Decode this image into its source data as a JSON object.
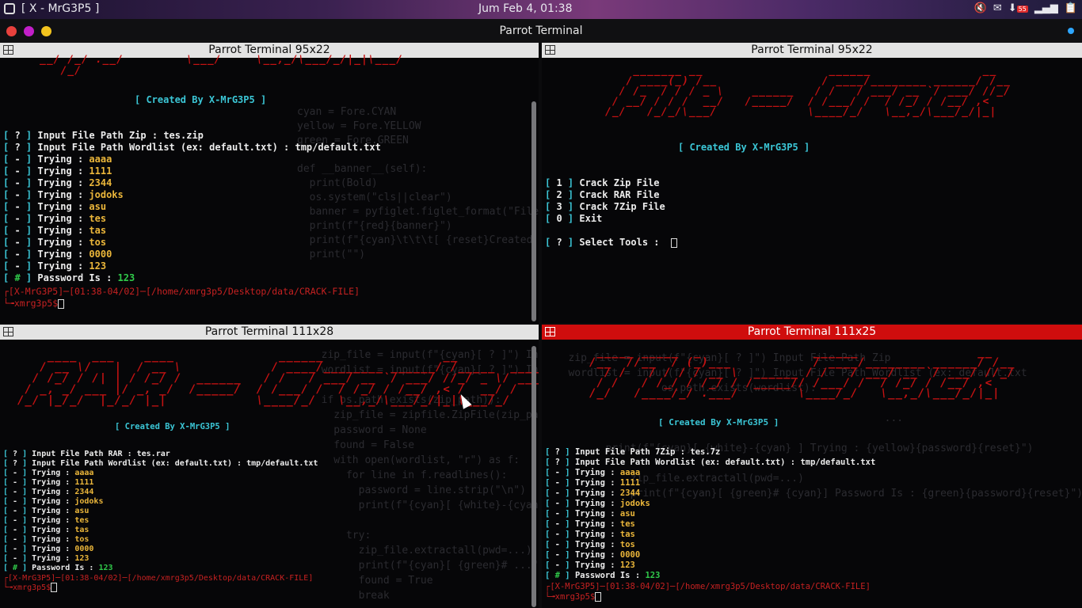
{
  "topbar": {
    "window_title": "[ X - MrG3P5 ]",
    "clock": "Jum Feb  4, 01:38",
    "tray_badge": "55"
  },
  "window": {
    "title": "Parrot Terminal"
  },
  "panes": {
    "tl": {
      "title": "Parrot Terminal 95x22",
      "created": "[ Created By X-MrG3P5 ]",
      "lines": [
        "[ ? ] Input File Path Zip : tes.zip",
        "[ ? ] Input File Path Wordlist (ex: default.txt) : tmp/default.txt",
        "[ - ] Trying : aaaa",
        "[ - ] Trying : 1111",
        "[ - ] Trying : 2344",
        "[ - ] Trying : jodoks",
        "[ - ] Trying : asu",
        "[ - ] Trying : tes",
        "[ - ] Trying : tas",
        "[ - ] Trying : tos",
        "[ - ] Trying : 0000",
        "[ - ] Trying : 123",
        "[ # ] Password Is : 123"
      ],
      "prompt1": "┌[X-MrG3P5]─[01:38-04/02]─[/home/xmrg3p5/Desktop/data/CRACK-FILE]",
      "prompt2": "└╼xmrg3p5$"
    },
    "tr": {
      "title": "Parrot Terminal 95x22",
      "created": "[ Created By X-MrG3P5 ]",
      "menu": [
        "[ 1 ] Crack Zip File",
        "[ 2 ] Crack RAR File",
        "[ 3 ] Crack 7Zip File",
        "[ 0 ] Exit"
      ],
      "select": "[ ? ] Select Tools : "
    },
    "bl": {
      "title": "Parrot Terminal 111x28",
      "created": "[ Created By X-MrG3P5 ]",
      "lines": [
        "[ ? ] Input File Path RAR : tes.rar",
        "[ ? ] Input File Path Wordlist (ex: default.txt) : tmp/default.txt",
        "[ - ] Trying : aaaa",
        "[ - ] Trying : 1111",
        "[ - ] Trying : 2344",
        "[ - ] Trying : jodoks",
        "[ - ] Trying : asu",
        "[ - ] Trying : tes",
        "[ - ] Trying : tas",
        "[ - ] Trying : tos",
        "[ - ] Trying : 0000",
        "[ - ] Trying : 123",
        "[ # ] Password Is : 123"
      ],
      "prompt1": "┌[X-MrG3P5]─[01:38-04/02]─[/home/xmrg3p5/Desktop/data/CRACK-FILE]",
      "prompt2": "└╼xmrg3p5$"
    },
    "br": {
      "title": "Parrot Terminal 111x25",
      "created": "[ Created By X-MrG3P5 ]",
      "lines": [
        "[ ? ] Input File Path 7Zip : tes.7z",
        "[ ? ] Input File Path Wordlist (ex: default.txt) : tmp/default.txt",
        "[ - ] Trying : aaaa",
        "[ - ] Trying : 1111",
        "[ - ] Trying : 2344",
        "[ - ] Trying : jodoks",
        "[ - ] Trying : asu",
        "[ - ] Trying : tes",
        "[ - ] Trying : tas",
        "[ - ] Trying : tos",
        "[ - ] Trying : 0000",
        "[ - ] Trying : 123",
        "[ # ] Password Is : 123"
      ],
      "prompt1": "┌[X-MrG3P5]─[01:38-04/02]─[/home/xmrg3p5/Desktop/data/CRACK-FILE]",
      "prompt2": "└╼xmrg3p5$"
    }
  }
}
